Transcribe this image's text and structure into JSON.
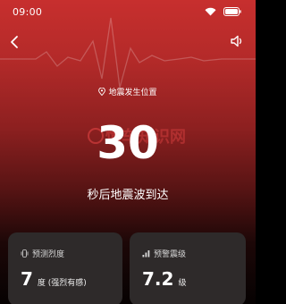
{
  "status_bar": {
    "time": "09:00"
  },
  "header": {
    "location_label": "地震发生位置"
  },
  "countdown": {
    "value": "30",
    "label": "秒后地震波到达"
  },
  "watermark": {
    "text": "懂车知识网"
  },
  "cards": [
    {
      "title": "预测烈度",
      "value": "7",
      "unit": "度 (强烈有感)",
      "icon": "phone-vibrate-icon"
    },
    {
      "title": "预警震级",
      "value": "7.2",
      "unit": "级",
      "icon": "signal-bars-icon"
    }
  ],
  "colors": {
    "background_top": "#c72f2e",
    "background_bottom": "#060202",
    "card": "#2e2a2a"
  }
}
